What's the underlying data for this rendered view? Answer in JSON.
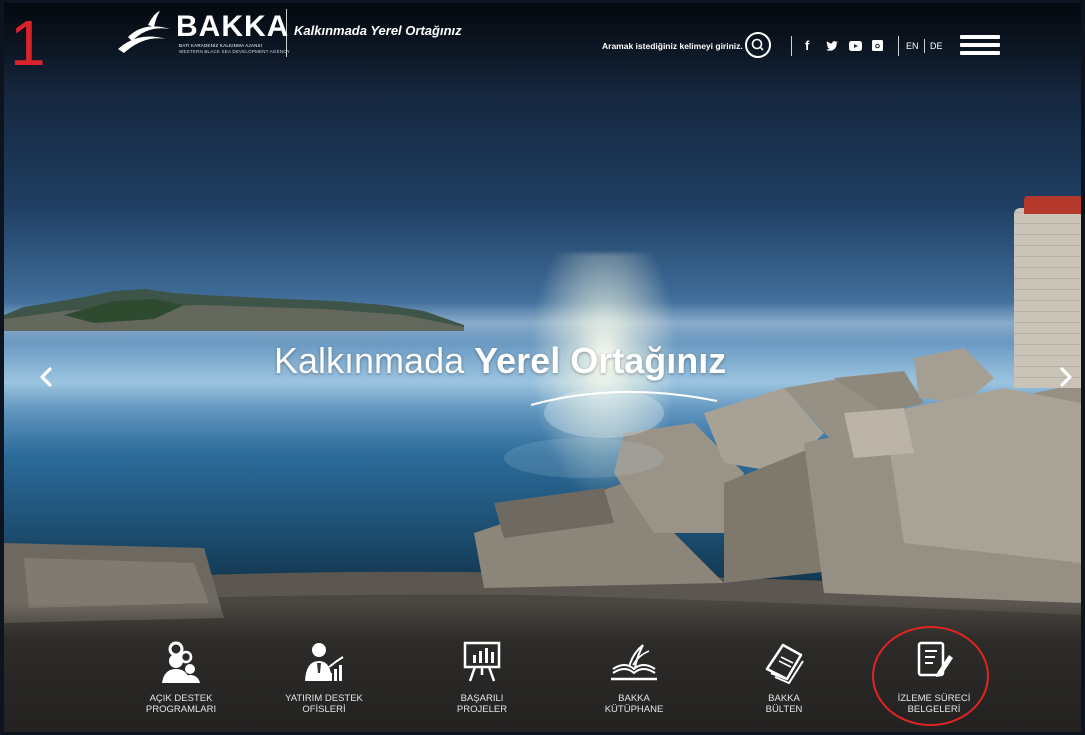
{
  "annotation": {
    "step_number": "1"
  },
  "header": {
    "logo": {
      "name": "BAKKA",
      "sub1": "BATI KARADENİZ KALKINMA AJANSI",
      "sub2": "WESTERN BLACK SEA DEVELOPMENT AGENCY"
    },
    "tagline": "Kalkınmada Yerel Ortağınız",
    "search": {
      "placeholder": "Aramak istediğiniz kelimeyi giriniz."
    },
    "social": [
      {
        "icon": "facebook-icon",
        "glyph": "f"
      },
      {
        "icon": "twitter-icon",
        "glyph": "🐦"
      },
      {
        "icon": "youtube-icon",
        "glyph": "▶"
      },
      {
        "icon": "instagram-icon",
        "glyph": "◙"
      }
    ],
    "languages": [
      "EN",
      "DE"
    ]
  },
  "hero": {
    "title_light": "Kalkınmada",
    "title_bold": "Yerel Ortağınız",
    "prev_icon": "chevron-left-icon",
    "next_icon": "chevron-right-icon"
  },
  "tiles": [
    {
      "label1": "AÇIK DESTEK",
      "label2": "PROGRAMLARI",
      "icon": "support-programs-icon"
    },
    {
      "label1": "YATIRIM DESTEK",
      "label2": "OFİSLERİ",
      "icon": "investment-office-icon"
    },
    {
      "label1": "BAŞARILI",
      "label2": "PROJELER",
      "icon": "presentation-chart-icon"
    },
    {
      "label1": "BAKKA",
      "label2": "KÜTÜPHANE",
      "icon": "library-book-icon"
    },
    {
      "label1": "BAKKA",
      "label2": "BÜLTEN",
      "icon": "bulletin-book-icon"
    },
    {
      "label1": "İZLEME SÜRECİ",
      "label2": "BELGELERİ",
      "icon": "monitoring-documents-icon"
    }
  ],
  "colors": {
    "highlight": "#e02424",
    "accent_red": "#d9232a"
  }
}
